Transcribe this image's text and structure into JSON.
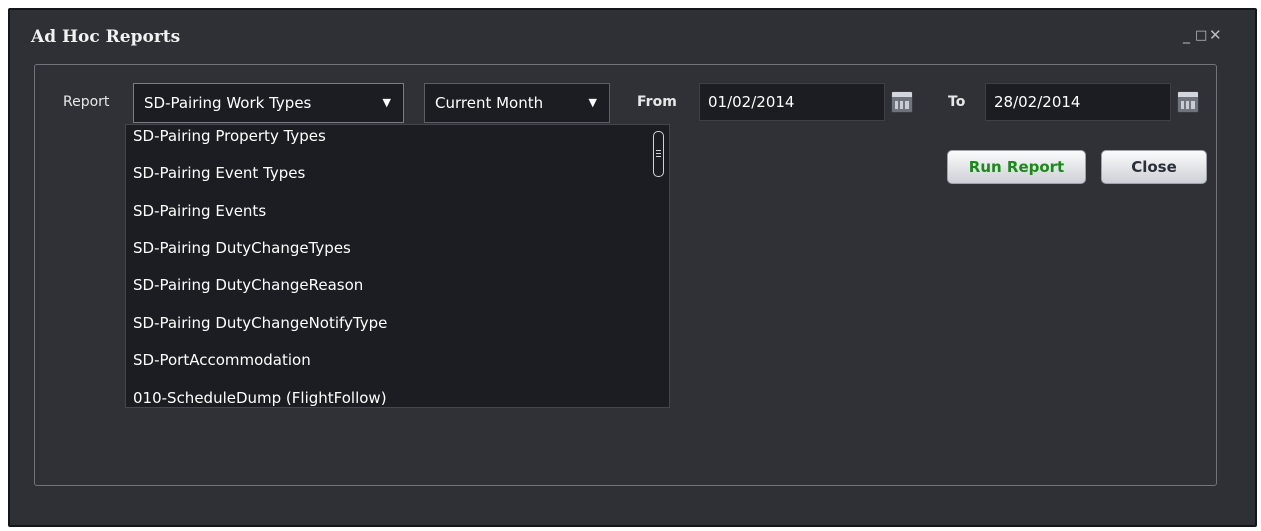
{
  "window": {
    "title": "Ad Hoc Reports",
    "controls": {
      "minimize": "_",
      "maximize": "□",
      "close": "✕"
    }
  },
  "form": {
    "report_label": "Report",
    "report_selected": "SD-Pairing Work Types",
    "period_selected": "Current Month",
    "from_label": "From",
    "from_value": "01/02/2014",
    "to_label": "To",
    "to_value": "28/02/2014",
    "dropdown_arrow": "▼"
  },
  "buttons": {
    "run_report": "Run Report",
    "close": "Close"
  },
  "report_options": [
    "SD-Pairing Property Types",
    "SD-Pairing Event Types",
    "SD-Pairing Events",
    "SD-Pairing DutyChangeTypes",
    "SD-Pairing DutyChangeReason",
    "SD-Pairing DutyChangeNotifyType",
    "SD-PortAccommodation",
    "010-ScheduleDump (FlightFollow)"
  ],
  "colors": {
    "window_bg": "#2f3035",
    "field_bg": "#1c1d22",
    "run_report_text": "#1a8a1a",
    "close_text": "#2a2f3a"
  },
  "icons": [
    "minimize-icon",
    "maximize-icon",
    "close-icon",
    "calendar-icon",
    "chevron-down-icon"
  ]
}
